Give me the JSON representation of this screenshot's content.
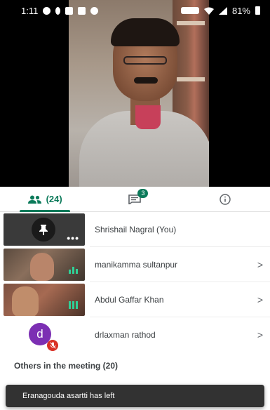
{
  "status_bar": {
    "time": "1:11",
    "battery": "81%"
  },
  "tabs": {
    "people_count": "(24)",
    "chat_badge": "3"
  },
  "participants": [
    {
      "name": "Shrishail Nagral (You)",
      "tile": "pinned",
      "has_chevron": false
    },
    {
      "name": "manikamma sultanpur",
      "tile": "camera",
      "has_chevron": true
    },
    {
      "name": "Abdul Gaffar Khan",
      "tile": "camera",
      "has_chevron": true
    },
    {
      "name": "drlaxman rathod",
      "tile": "avatar",
      "avatar_letter": "d",
      "avatar_color": "#7c2fb3",
      "muted": true,
      "has_chevron": true
    }
  ],
  "chevron": ">",
  "more_dots": "•••",
  "others_section": "Others in the meeting (20)",
  "snackbar": "Eranagouda asartti has left",
  "colors": {
    "accent": "#0b7a5a",
    "mute_red": "#d93025",
    "snackbar_bg": "#323232"
  },
  "icons": [
    "wifi-icon",
    "signal-icon",
    "people-icon",
    "chat-icon",
    "info-icon",
    "pin-icon",
    "mic-off-icon",
    "audio-level-icon",
    "chevron-right-icon"
  ]
}
